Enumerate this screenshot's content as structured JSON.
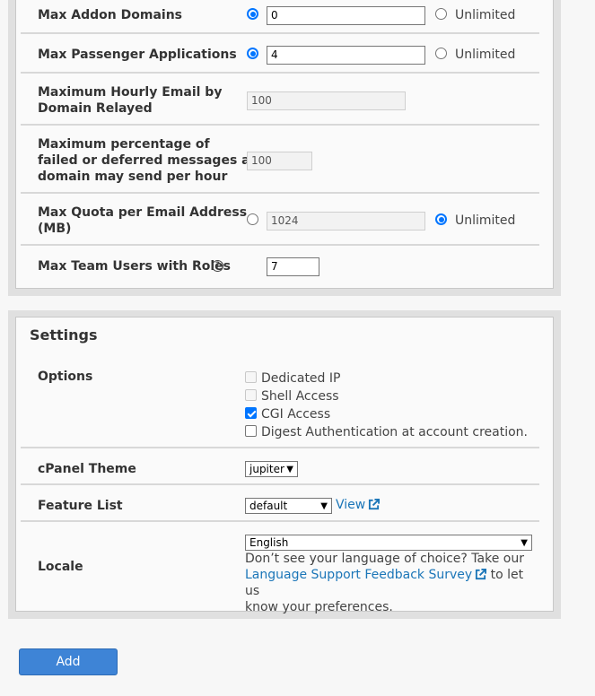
{
  "limits": {
    "rows": [
      {
        "label": "Max Addon Domains",
        "value": "0",
        "unlimited": "Unlimited"
      },
      {
        "label": "Max Passenger Applications",
        "value": "4",
        "unlimited": "Unlimited"
      },
      {
        "label_l1": "Maximum Hourly Email by",
        "label_l2": "Domain Relayed",
        "value": "100"
      },
      {
        "label_l1": "Maximum percentage of",
        "label_l2": "failed or deferred messages a",
        "label_l3": "domain may send per hour",
        "value": "100"
      },
      {
        "label_l1": "Max Quota per Email Address",
        "label_l2": "(MB)",
        "value": "1024",
        "unlimited": "Unlimited"
      },
      {
        "label": "Max Team Users with Roles",
        "value": "7"
      }
    ]
  },
  "settings": {
    "title": "Settings",
    "options_label": "Options",
    "options": [
      {
        "label": "Dedicated IP",
        "checked": false,
        "disabled": true
      },
      {
        "label": "Shell Access",
        "checked": false,
        "disabled": true
      },
      {
        "label": "CGI Access",
        "checked": true,
        "disabled": false
      },
      {
        "label": "Digest Authentication at account creation.",
        "checked": false,
        "disabled": false
      }
    ],
    "theme_label": "cPanel Theme",
    "theme_value": "jupiter",
    "feature_label": "Feature List",
    "feature_value": "default",
    "view_link": "View",
    "locale_label": "Locale",
    "locale_value": "English",
    "locale_text_1": "Don’t see your language of choice? Take our",
    "locale_link": "Language Support Feedback Survey",
    "locale_text_2": "to let us",
    "locale_text_3": "know your preferences."
  },
  "add_button": "Add",
  "icons": {
    "help": "help-circle-icon",
    "external": "external-link-icon"
  },
  "colors": {
    "accent": "#0075ff",
    "link": "#1b76b8",
    "button": "#3e84d6"
  }
}
